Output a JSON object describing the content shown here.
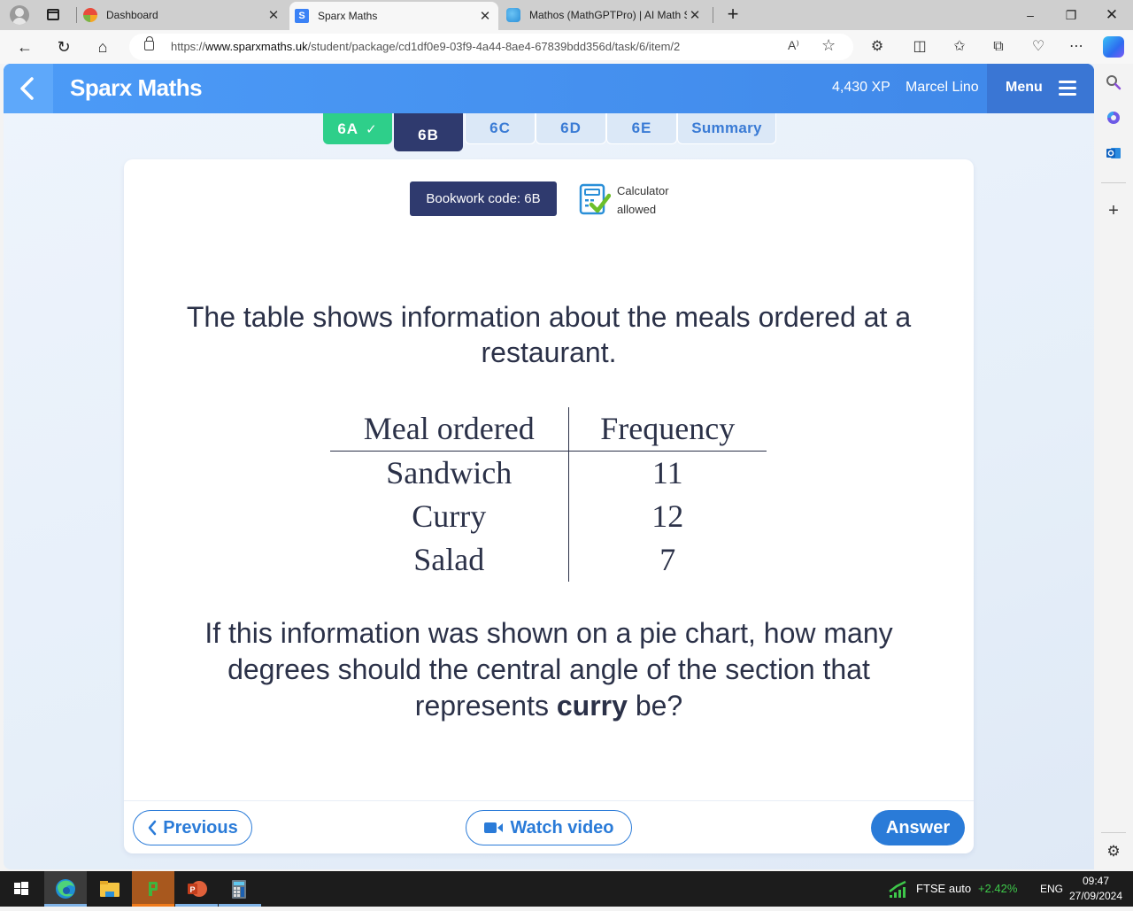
{
  "browser": {
    "tabs": [
      {
        "label": "Dashboard",
        "icon": "dashboard-favicon"
      },
      {
        "label": "Sparx Maths",
        "icon": "sparx-favicon",
        "active": true
      },
      {
        "label": "Mathos (MathGPTPro) | AI Math S",
        "icon": "mathos-favicon"
      }
    ],
    "url_prefix": "https://",
    "url_domain": "www.sparxmaths.uk",
    "url_path": "/student/package/cd1df0e9-03f9-4a44-8ae4-67839bdd356d/task/6/item/2",
    "read_aloud_label": "A⁾"
  },
  "header": {
    "brand": "Sparx Maths",
    "xp": "4,430 XP",
    "user_name": "Marcel Lino",
    "menu_label": "Menu"
  },
  "task_tabs": [
    {
      "label": "6A",
      "state": "complete"
    },
    {
      "label": "6B",
      "state": "active"
    },
    {
      "label": "6C",
      "state": "idle"
    },
    {
      "label": "6D",
      "state": "idle"
    },
    {
      "label": "6E",
      "state": "idle"
    },
    {
      "label": "Summary",
      "state": "idle"
    }
  ],
  "question": {
    "bookwork_code": "Bookwork code: 6B",
    "calculator_line1": "Calculator",
    "calculator_line2": "allowed",
    "intro": "The table shows information about the meals ordered at a restaurant.",
    "table": {
      "headers": [
        "Meal ordered",
        "Frequency"
      ],
      "rows": [
        [
          "Sandwich",
          "11"
        ],
        [
          "Curry",
          "12"
        ],
        [
          "Salad",
          "7"
        ]
      ]
    },
    "prompt_before": "If this information was shown on a pie chart, how many degrees should the central angle of the section that represents ",
    "prompt_bold": "curry",
    "prompt_after": " be?"
  },
  "footer": {
    "previous_label": "Previous",
    "watch_video_label": "Watch video",
    "answer_label": "Answer"
  },
  "taskbar": {
    "stock_name": "FTSE auto",
    "stock_change": "+2.42%",
    "language": "ENG",
    "time": "09:47",
    "date": "27/09/2024"
  },
  "colors": {
    "brand_blue": "#3f87e8",
    "complete_green": "#2ecf8a",
    "active_navy": "#2f3a6e",
    "button_blue": "#2a7bd8",
    "stock_green": "#3ec84a"
  }
}
